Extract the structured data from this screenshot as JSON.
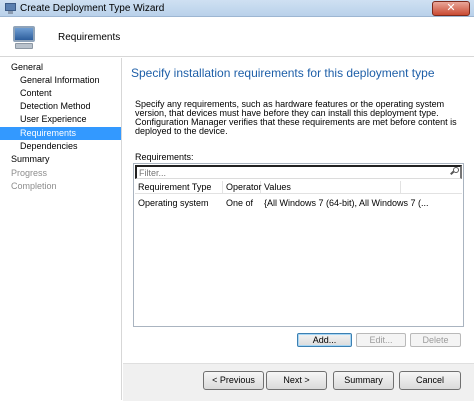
{
  "window": {
    "title": "Create Deployment Type Wizard",
    "close_glyph": "✕"
  },
  "header": {
    "title": "Requirements",
    "icon": "computer-icon"
  },
  "nav": {
    "items": [
      {
        "label": "General",
        "level": 1,
        "state": "normal"
      },
      {
        "label": "General Information",
        "level": 2,
        "state": "normal"
      },
      {
        "label": "Content",
        "level": 2,
        "state": "normal"
      },
      {
        "label": "Detection Method",
        "level": 2,
        "state": "normal"
      },
      {
        "label": "User Experience",
        "level": 2,
        "state": "normal"
      },
      {
        "label": "Requirements",
        "level": 2,
        "state": "selected"
      },
      {
        "label": "Dependencies",
        "level": 2,
        "state": "normal"
      },
      {
        "label": "Summary",
        "level": 1,
        "state": "normal"
      },
      {
        "label": "Progress",
        "level": 1,
        "state": "disabled"
      },
      {
        "label": "Completion",
        "level": 1,
        "state": "disabled"
      }
    ]
  },
  "main": {
    "title": "Specify installation requirements for this deployment type",
    "description": "Specify any requirements, such as hardware features or the operating system version, that devices must have before they can install this deployment type. Configuration Manager verifies that these requirements are met before content is deployed to the device.",
    "requirements_label": "Requirements:",
    "filter_placeholder": "Filter...",
    "columns": [
      "Requirement Type",
      "Operator",
      "Values"
    ],
    "rows": [
      {
        "type": "Operating system",
        "operator": "One of",
        "values": "{All Windows 7 (64-bit), All Windows 7 (..."
      }
    ],
    "buttons": {
      "add": "Add...",
      "edit": "Edit...",
      "delete": "Delete"
    }
  },
  "footer": {
    "previous": "< Previous",
    "next": "Next >",
    "summary": "Summary",
    "cancel": "Cancel"
  },
  "colors": {
    "accent": "#3399ff",
    "title_blue": "#1e5fa8"
  }
}
